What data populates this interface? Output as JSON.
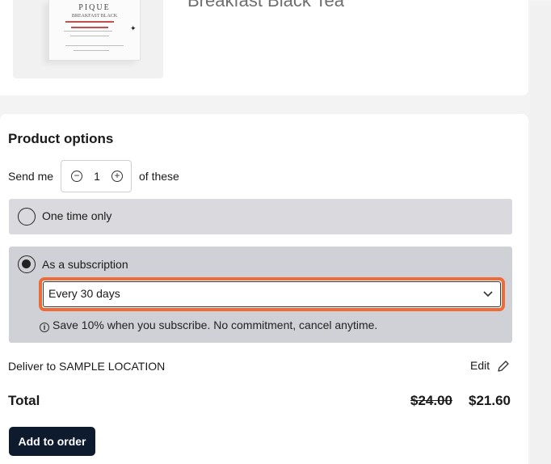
{
  "product": {
    "title_fragment": "Breakfast Black Tea",
    "image_brand": "PIQUE",
    "image_subtitle": "BREAKFAST BLACK"
  },
  "options": {
    "heading": "Product options",
    "send_prefix": "Send me",
    "quantity": "1",
    "send_suffix": "of these",
    "one_time_label": "One time only",
    "subscription_label": "As a subscription",
    "frequency_value": "Every 30 days",
    "note": "Save 10% when you subscribe. No commitment, cancel anytime.",
    "selected": "subscription"
  },
  "delivery": {
    "label": "Deliver to SAMPLE LOCATION",
    "edit_label": "Edit"
  },
  "totals": {
    "label": "Total",
    "original_price": "$24.00",
    "price": "$21.60"
  },
  "actions": {
    "add_label": "Add to order"
  },
  "colors": {
    "highlight": "#f06a38",
    "button_bg": "#0e1a2e",
    "option_bg": "#d9d9de"
  }
}
